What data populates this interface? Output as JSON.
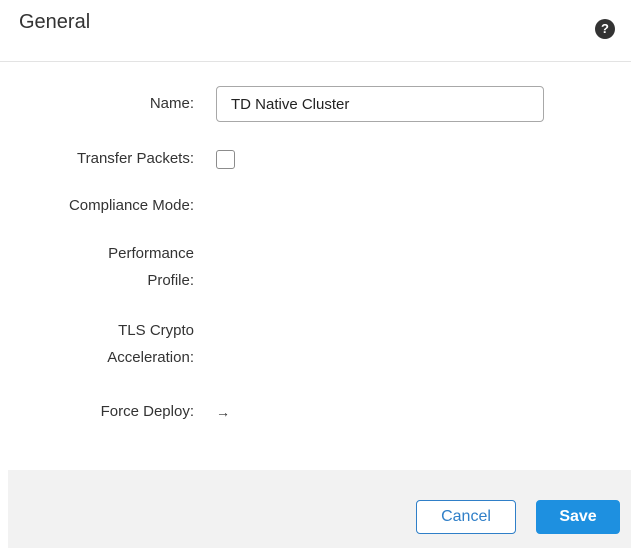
{
  "header": {
    "title": "General",
    "help_icon": "?"
  },
  "form": {
    "name_label": "Name:",
    "name_value": "TD Native Cluster",
    "transfer_packets_label": "Transfer Packets:",
    "transfer_packets_checked": false,
    "compliance_mode_label": "Compliance Mode:",
    "performance_profile_label_line1": "Performance",
    "performance_profile_label_line2": "Profile:",
    "tls_crypto_label_line1": "TLS Crypto",
    "tls_crypto_label_line2": "Acceleration:",
    "force_deploy_label": "Force Deploy:",
    "force_deploy_icon": "→"
  },
  "footer": {
    "cancel_label": "Cancel",
    "save_label": "Save"
  },
  "colors": {
    "accent": "#1e90e0",
    "cancel_border": "#2f7fc8",
    "footer_bg": "#f2f2f2"
  }
}
